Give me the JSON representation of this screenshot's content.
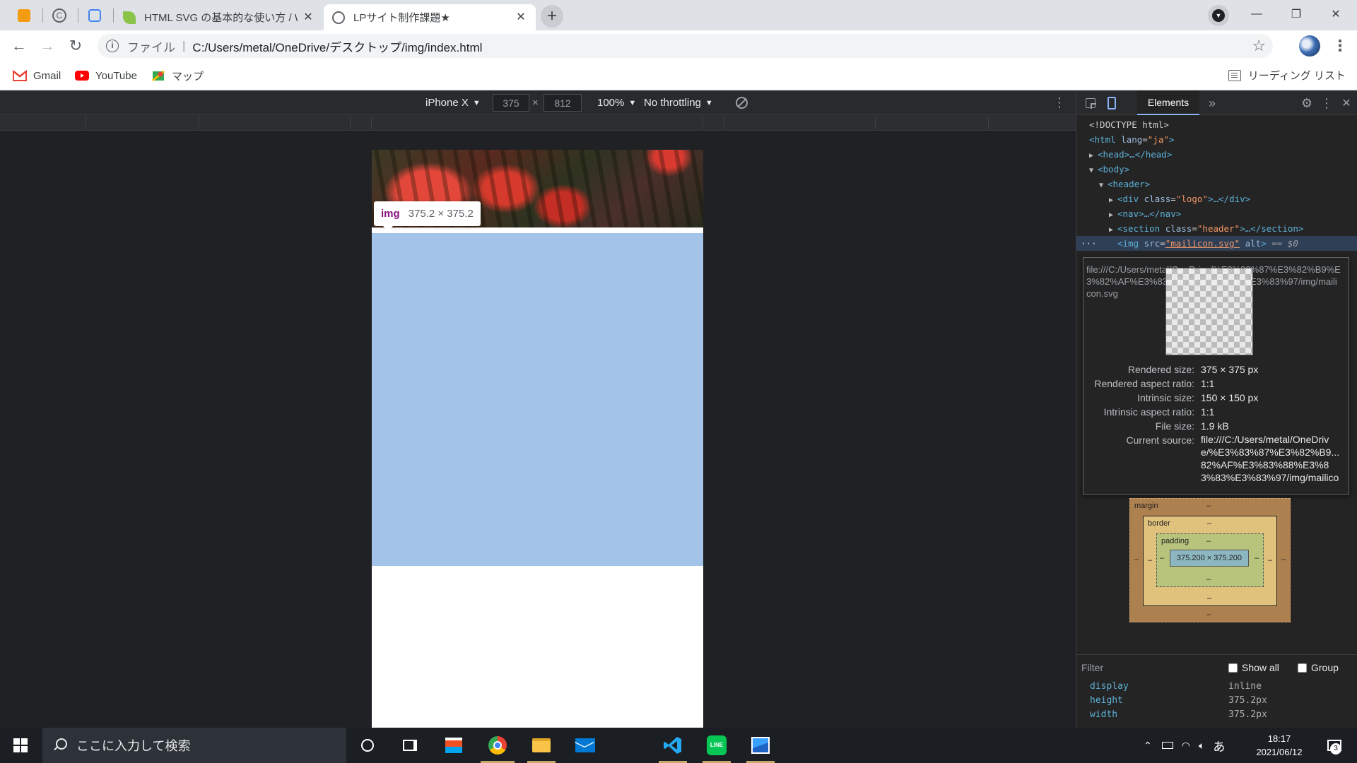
{
  "browser": {
    "tabs": [
      {
        "title": "HTML SVG の基本的な使い方 / Web"
      },
      {
        "title": "LPサイト制作課題★"
      }
    ],
    "address": {
      "scheme_label": "ファイル",
      "path": "C:/Users/metal/OneDrive/デスクトップ/img/index.html"
    },
    "bookmarks": [
      {
        "label": "Gmail"
      },
      {
        "label": "YouTube"
      },
      {
        "label": "マップ"
      }
    ],
    "reading_list_label": "リーディング リスト"
  },
  "device_toolbar": {
    "device": "iPhone X",
    "width": "375",
    "times": "×",
    "height": "812",
    "zoom": "100%",
    "throttling": "No throttling"
  },
  "inspect_tooltip": {
    "tag": "img",
    "size": "375.2 × 375.2"
  },
  "devtools": {
    "tab_label": "Elements",
    "dom": [
      {
        "text": "<!DOCTYPE html>"
      },
      {
        "open": "<html ",
        "attr": "lang",
        "eq": "=",
        "val": "\"ja\"",
        "close": ">"
      },
      {
        "tag": "<head>…</head>"
      },
      {
        "tag": "<body>"
      },
      {
        "tag": "<header>"
      },
      {
        "open": "<div ",
        "attr": "class",
        "eq": "=",
        "val": "\"logo\"",
        "close": ">…</div>"
      },
      {
        "tag": "<nav>…</nav>"
      },
      {
        "open": "<section ",
        "attr": "class",
        "eq": "=",
        "val": "\"header\"",
        "close": ">…</section>"
      },
      {
        "open": "<img ",
        "attr": "src",
        "eq": "=",
        "val": "\"mailicon.svg\"",
        "attr2": " alt",
        "close": ">",
        "marker": " == $0"
      }
    ],
    "image_popup": {
      "url": "file:///C:/Users/metal/OneDrive/%E3%83%87%E3%82%B9%E3%82%AF%E3%83%88%E3%83%83%E3%83%97/img/mailicon.svg",
      "rows": [
        {
          "k": "Rendered size:",
          "v": "375 × 375 px"
        },
        {
          "k": "Rendered aspect ratio:",
          "v": "1:1"
        },
        {
          "k": "Intrinsic size:",
          "v": "150 × 150 px"
        },
        {
          "k": "Intrinsic aspect ratio:",
          "v": "1:1"
        },
        {
          "k": "File size:",
          "v": "1.9 kB"
        },
        {
          "k": "Current source:",
          "v": "file:///C:/Users/metal/OneDrive/%E3%83%87%E3%82%B9...82%AF%E3%83%88%E3%83%83%E3%83%97/img/mailicon.svg"
        }
      ]
    },
    "box_model": {
      "margin_label": "margin",
      "border_label": "border",
      "padding_label": "padding",
      "content_size": "375.200 × 375.200",
      "dash": "–"
    },
    "filter_placeholder": "Filter",
    "show_all_label": "Show all",
    "group_label": "Group",
    "computed": [
      {
        "prop": "display",
        "val": "inline"
      },
      {
        "prop": "height",
        "val": "375.2px"
      },
      {
        "prop": "width",
        "val": "375.2px"
      }
    ]
  },
  "taskbar": {
    "search_placeholder": "ここに入力して検索",
    "time": "18:17",
    "date": "2021/06/12",
    "ime": "あ",
    "notification_count": "3"
  },
  "colors": {
    "highlight": "#a3c4e8",
    "devtools_bg": "#242424",
    "accent": "#8ab4f8"
  }
}
